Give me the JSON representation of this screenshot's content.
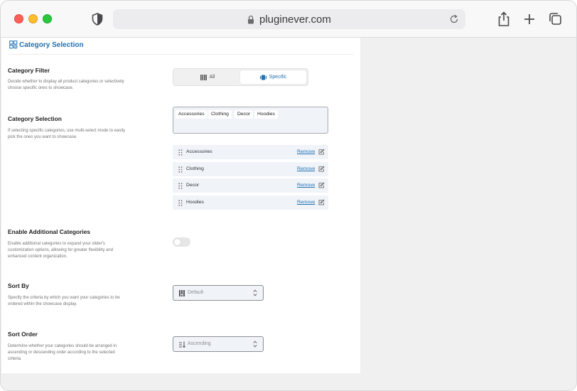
{
  "browser": {
    "url": "pluginever.com"
  },
  "header": {
    "title": "Category Selection",
    "icon": "category-grid-icon"
  },
  "category_filter": {
    "title": "Category Filter",
    "description": "Decide whether to display all product categories or selectively choose specific ones to showcase.",
    "options": [
      {
        "label": "All",
        "icon": "columns-icon",
        "selected": false
      },
      {
        "label": "Specific",
        "icon": "carousel-icon",
        "selected": true
      }
    ]
  },
  "category_selection": {
    "title": "Category Selection",
    "description": "If selecting specific categories, use multi-select mode to easily pick the ones you want to showcase.",
    "chips": [
      "Accessories",
      "Clothing",
      "Decor",
      "Hoodies"
    ],
    "items": [
      {
        "label": "Accessories",
        "action": "Remove"
      },
      {
        "label": "Clothing",
        "action": "Remove"
      },
      {
        "label": "Decor",
        "action": "Remove"
      },
      {
        "label": "Hoodies",
        "action": "Remove"
      }
    ]
  },
  "additional_categories": {
    "title": "Enable Additional Categories",
    "description": "Enable additional categories to expand your slider's customization options, allowing for greater flexibility and enhanced content organization.",
    "enabled": false
  },
  "sort_by": {
    "title": "Sort By",
    "description": "Specify the criteria by which you want your categories to be ordered within the showcase display.",
    "value": "Default"
  },
  "sort_order": {
    "title": "Sort Order",
    "description": "Determine whether your categories should be arranged in ascending or descending order according to the selected criteria.",
    "value": "Ascending"
  },
  "colors": {
    "accent": "#2271b1",
    "field_bg": "#f0f3f8"
  }
}
